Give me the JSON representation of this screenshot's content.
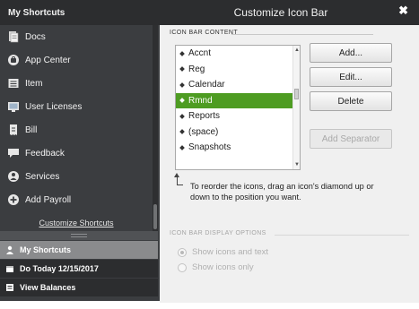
{
  "sidebar": {
    "header": "My Shortcuts",
    "items": [
      {
        "label": "Docs",
        "icon": "docs-icon"
      },
      {
        "label": "App Center",
        "icon": "app-center-icon"
      },
      {
        "label": "Item",
        "icon": "item-icon"
      },
      {
        "label": "User Licenses",
        "icon": "user-licenses-icon"
      },
      {
        "label": "Bill",
        "icon": "bill-icon"
      },
      {
        "label": "Feedback",
        "icon": "feedback-icon"
      },
      {
        "label": "Services",
        "icon": "services-icon"
      },
      {
        "label": "Add Payroll",
        "icon": "add-payroll-icon"
      }
    ],
    "customize_link": "Customize Shortcuts",
    "tabs": [
      {
        "label": "My Shortcuts",
        "icon": "user-icon"
      },
      {
        "label": "Do Today 12/15/2017",
        "icon": "calendar-icon"
      },
      {
        "label": "View Balances",
        "icon": "balances-icon"
      }
    ]
  },
  "dialog": {
    "title": "Customize Icon Bar",
    "close_glyph": "✖",
    "section_content": "ICON BAR CONTENT",
    "list_items": [
      "Accnt",
      "Reg",
      "Calendar",
      "Rmnd",
      "Reports",
      "(space)",
      "Snapshots"
    ],
    "selected_item": "Rmnd",
    "buttons": {
      "add": "Add...",
      "edit": "Edit...",
      "delete": "Delete",
      "add_separator": "Add Separator"
    },
    "hint": "To reorder the icons, drag an icon's diamond up or down to the position you want.",
    "section_display": "ICON BAR DISPLAY OPTIONS",
    "display_options": [
      {
        "label": "Show icons and text",
        "checked": true
      },
      {
        "label": "Show icons only",
        "checked": false
      }
    ]
  },
  "colors": {
    "selection": "#4e9c22",
    "sidebar_bg": "#3b3d40",
    "title_bar": "#2c2d2f"
  }
}
